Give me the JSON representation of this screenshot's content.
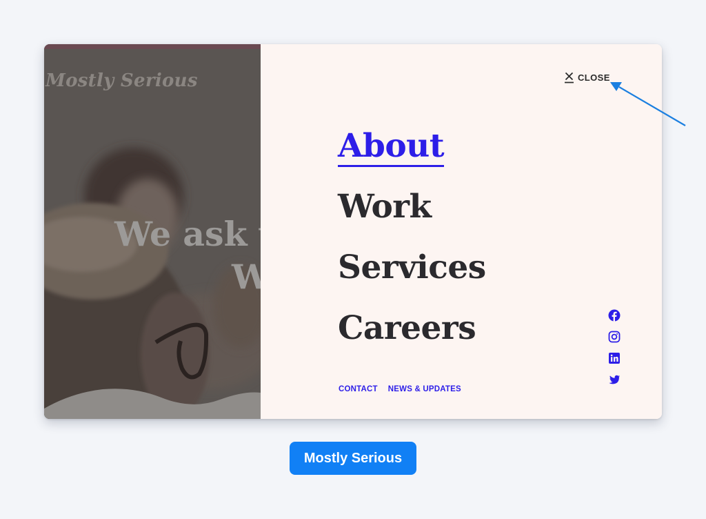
{
  "hero": {
    "logo_text": "Mostly Serious",
    "headline_line1": "We ask w",
    "headline_line2": "W"
  },
  "menu": {
    "close_label": "CLOSE",
    "nav_items": [
      {
        "label": "About",
        "active": true
      },
      {
        "label": "Work",
        "active": false
      },
      {
        "label": "Services",
        "active": false
      },
      {
        "label": "Careers",
        "active": false
      }
    ],
    "footer_links": [
      {
        "label": "CONTACT"
      },
      {
        "label": "NEWS & UPDATES"
      }
    ],
    "social": [
      {
        "icon": "facebook-icon"
      },
      {
        "icon": "instagram-icon"
      },
      {
        "icon": "linkedin-icon"
      },
      {
        "icon": "twitter-icon"
      }
    ]
  },
  "caption": {
    "button_label": "Mostly Serious"
  },
  "colors": {
    "accent": "#2d1ee8",
    "panel_bg": "#fdf5f2",
    "page_bg": "#f3f5f9",
    "cta_bg": "#1180f5",
    "annotation": "#1b7fe0"
  }
}
